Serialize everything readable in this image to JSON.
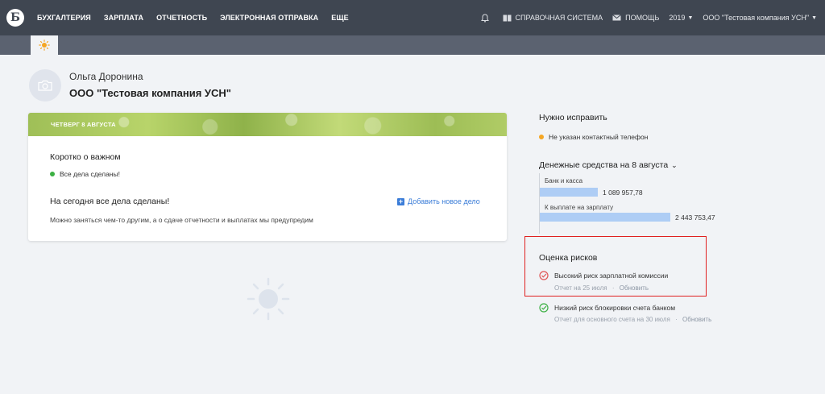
{
  "nav": {
    "logo_letter": "Б",
    "items": [
      "БУХГАЛТЕРИЯ",
      "ЗАРПЛАТА",
      "ОТЧЕТНОСТЬ",
      "ЭЛЕКТРОННАЯ ОТПРАВКА",
      "ЕЩЕ"
    ],
    "help_system": "СПРАВОЧНАЯ СИСТЕМА",
    "help": "ПОМОЩЬ",
    "year": "2019",
    "company": "ООО \"Тестовая компания УСН\""
  },
  "profile": {
    "user_name": "Ольга Доронина",
    "company": "ООО \"Тестовая компания УСН\""
  },
  "card": {
    "banner": "ЧЕТВЕРГ 8 АВГУСТА",
    "important_title": "Коротко о важном",
    "status": "Все дела сделаны!",
    "today_title": "На сегодня все дела сделаны!",
    "add_task": "Добавить новое дело",
    "description": "Можно заняться чем-то другим, а о сдаче отчетности и выплатах мы предупредим"
  },
  "fix": {
    "title": "Нужно исправить",
    "item": "Не указан контактный телефон"
  },
  "money": {
    "title": "Денежные средства на 8 августа",
    "rows": [
      {
        "label": "Банк и касса",
        "value": "1 089 957,78",
        "amount": 1089957.78
      },
      {
        "label": "К выплате на зарплату",
        "value": "2 443 753,47",
        "amount": 2443753.47
      }
    ]
  },
  "risks": {
    "title": "Оценка рисков",
    "items": [
      {
        "text": "Высокий риск зарплатной комиссии",
        "report": "Отчет на 25 июля",
        "sep": "·",
        "link": "Обновить"
      },
      {
        "text": "Низкий риск блокировки счета банком",
        "report": "Отчет для основного счета на 30 июля",
        "sep": "·",
        "link": "Обновить"
      }
    ]
  },
  "colors": {
    "nav_bg": "#3f4651",
    "accent_blue": "#3b7dd8",
    "ok_green": "#3cb043",
    "warn_orange": "#f5a623",
    "risk_red": "#e02020"
  }
}
